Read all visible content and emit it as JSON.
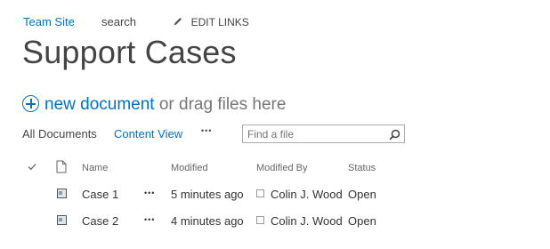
{
  "topnav": {
    "site_link": "Team Site",
    "search_link": "search",
    "edit_links": "EDIT LINKS"
  },
  "page": {
    "title": "Support Cases"
  },
  "upload": {
    "new_document": "new document",
    "drag_text": "or drag files here"
  },
  "views": {
    "all_documents": "All Documents",
    "content_view": "Content View",
    "more": "•••"
  },
  "search": {
    "placeholder": "Find a file",
    "value": ""
  },
  "table": {
    "columns": [
      "Name",
      "Modified",
      "Modified By",
      "Status"
    ],
    "rows": [
      {
        "name": "Case 1",
        "modified": "5 minutes ago",
        "modified_by": "Colin J. Wood",
        "status": "Open"
      },
      {
        "name": "Case 2",
        "modified": "4 minutes ago",
        "modified_by": "Colin J. Wood",
        "status": "Open"
      }
    ],
    "row_menu": "•••"
  },
  "colors": {
    "link": "#0072c6",
    "text": "#444444"
  }
}
